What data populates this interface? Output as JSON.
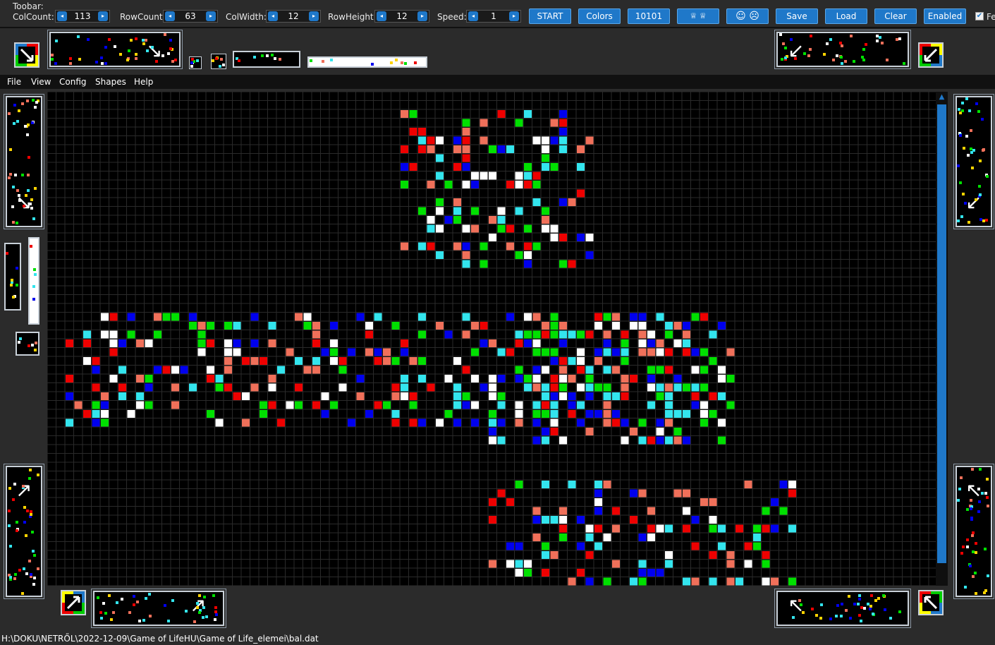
{
  "toolbar": {
    "caption": "Toobar:",
    "colcount_label": "ColCount:",
    "colcount_value": "113",
    "rowcount_label": "RowCount:",
    "rowcount_value": "63",
    "colwidth_label": "ColWidth:",
    "colwidth_value": "12",
    "rowheight_label": "RowHeight:",
    "rowheight_value": "12",
    "speed_label": "Speed:",
    "speed_value": "1",
    "start_label": "START",
    "colors_label": "Colors",
    "binary_label": "10101",
    "crown_label": "♕ ♕",
    "faces_label": "☺ ☹",
    "save_label": "Save",
    "load_label": "Load",
    "clear_label": "Clear",
    "enabled_label": "Enabled",
    "cutoff_label": "Fe"
  },
  "menu": {
    "file": "File",
    "view": "View",
    "config": "Config",
    "shapes": "Shapes",
    "help": "Help"
  },
  "status": {
    "path": "H:\\DOKU\\NETRŐL\\2022-12-09\\Game of LifeHU\\Game of Life_elemei\\bal.dat"
  },
  "colors": {
    "accent": "#1f78c9",
    "cell_white": "#ffffff",
    "cell_green": "#00e000",
    "cell_red": "#ee0000",
    "cell_blue": "#0000ee",
    "cell_cyan": "#33e5ee",
    "cell_salmon": "#f0705a",
    "grid_line": "#2a2a2a",
    "background": "#000000"
  },
  "icons": {
    "arrow_se": "↘",
    "arrow_sw": "↙",
    "arrow_ne": "↗",
    "arrow_nw": "↖",
    "stepper_left": "◂",
    "stepper_right": "▸",
    "scroll_up": "▲",
    "checkmark": "✔"
  }
}
